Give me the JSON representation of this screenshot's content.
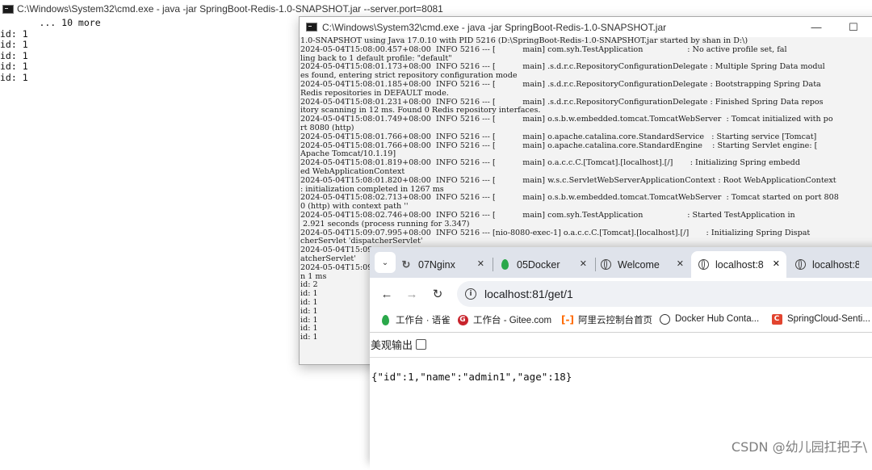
{
  "back_console": {
    "title": "C:\\Windows\\System32\\cmd.exe - java  -jar SpringBoot-Redis-1.0-SNAPSHOT.jar --server.port=8081",
    "lines": [
      "       ... 10 more",
      "id: 1",
      "id: 1",
      "id: 1",
      "id: 1",
      "id: 1"
    ]
  },
  "front_console": {
    "title": "C:\\Windows\\System32\\cmd.exe - java  -jar SpringBoot-Redis-1.0-SNAPSHOT.jar",
    "controls": {
      "minimize": "—",
      "maximize": "☐",
      "close": "✕"
    },
    "lines": [
      "1.0-SNAPSHOT using Java 17.0.10 with PID 5216 (D:\\SpringBoot-Redis-1.0-SNAPSHOT.jar started by shan in D:\\)",
      "2024-05-04T15:08:00.457+08:00  INFO 5216 --- [           main] com.syh.TestApplication                  : No active profile set, fal",
      "ling back to 1 default profile: \"default\"",
      "2024-05-04T15:08:01.173+08:00  INFO 5216 --- [           main] .s.d.r.c.RepositoryConfigurationDelegate : Multiple Spring Data modul",
      "es found, entering strict repository configuration mode",
      "2024-05-04T15:08:01.185+08:00  INFO 5216 --- [           main] .s.d.r.c.RepositoryConfigurationDelegate : Bootstrapping Spring Data",
      "Redis repositories in DEFAULT mode.",
      "2024-05-04T15:08:01.231+08:00  INFO 5216 --- [           main] .s.d.r.c.RepositoryConfigurationDelegate : Finished Spring Data repos",
      "itory scanning in 12 ms. Found 0 Redis repository interfaces.",
      "2024-05-04T15:08:01.749+08:00  INFO 5216 --- [           main] o.s.b.w.embedded.tomcat.TomcatWebServer  : Tomcat initialized with po",
      "rt 8080 (http)",
      "2024-05-04T15:08:01.766+08:00  INFO 5216 --- [           main] o.apache.catalina.core.StandardService   : Starting service [Tomcat]",
      "2024-05-04T15:08:01.766+08:00  INFO 5216 --- [           main] o.apache.catalina.core.StandardEngine    : Starting Servlet engine: [",
      "Apache Tomcat/10.1.19]",
      "2024-05-04T15:08:01.819+08:00  INFO 5216 --- [           main] o.a.c.c.C.[Tomcat].[localhost].[/]       : Initializing Spring embedd",
      "ed WebApplicationContext",
      "2024-05-04T15:08:01.820+08:00  INFO 5216 --- [           main] w.s.c.ServletWebServerApplicationContext : Root WebApplicationContext",
      ": initialization completed in 1267 ms",
      "2024-05-04T15:08:02.713+08:00  INFO 5216 --- [           main] o.s.b.w.embedded.tomcat.TomcatWebServer  : Tomcat started on port 808",
      "0 (http) with context path ''",
      "2024-05-04T15:08:02.746+08:00  INFO 5216 --- [           main] com.syh.TestApplication                  : Started TestApplication in",
      " 2.921 seconds (process running for 3.347)",
      "2024-05-04T15:09:07.995+08:00  INFO 5216 --- [nio-8080-exec-1] o.a.c.c.C.[Tomcat].[localhost].[/]       : Initializing Spring Dispat",
      "cherServlet 'dispatcherServlet'",
      "2024-05-04T15:09",
      "atcherServlet'",
      "2024-05-04T15:09",
      "n 1 ms",
      "id: 2",
      "id: 1",
      "id: 1",
      "id: 1",
      "id: 1",
      "id: 1",
      "id: 1"
    ]
  },
  "browser": {
    "tabs": [
      {
        "label": "07Nginx",
        "icon": "refresh-icon"
      },
      {
        "label": "05Docker",
        "icon": "leaf-icon"
      },
      {
        "label": "Welcome",
        "icon": "globe-icon"
      },
      {
        "label": "localhost:8",
        "icon": "globe-icon",
        "active": true
      },
      {
        "label": "localhost:8",
        "icon": "globe-icon"
      }
    ],
    "url": "localhost:81/get/1",
    "bookmarks": [
      {
        "label": "工作台 · 语雀",
        "icon": "yuque-leaf-icon"
      },
      {
        "label": "工作台 - Gitee.com",
        "icon": "gitee-icon"
      },
      {
        "label": "阿里云控制台首页",
        "icon": "aliyun-icon"
      },
      {
        "label": "Docker Hub Conta...",
        "icon": "docker-icon"
      },
      {
        "label": "SpringCloud-Senti...",
        "icon": "springcloud-icon"
      }
    ],
    "pretty_print_label": "美观输出",
    "json_output": "{\"id\":1,\"name\":\"admin1\",\"age\":18}"
  },
  "watermark": "CSDN @幼儿园扛把子\\",
  "colors": {
    "tabstrip": "#dfe3eb",
    "console_bg": "#f3f3f3",
    "omnibox": "#eff1f5"
  }
}
